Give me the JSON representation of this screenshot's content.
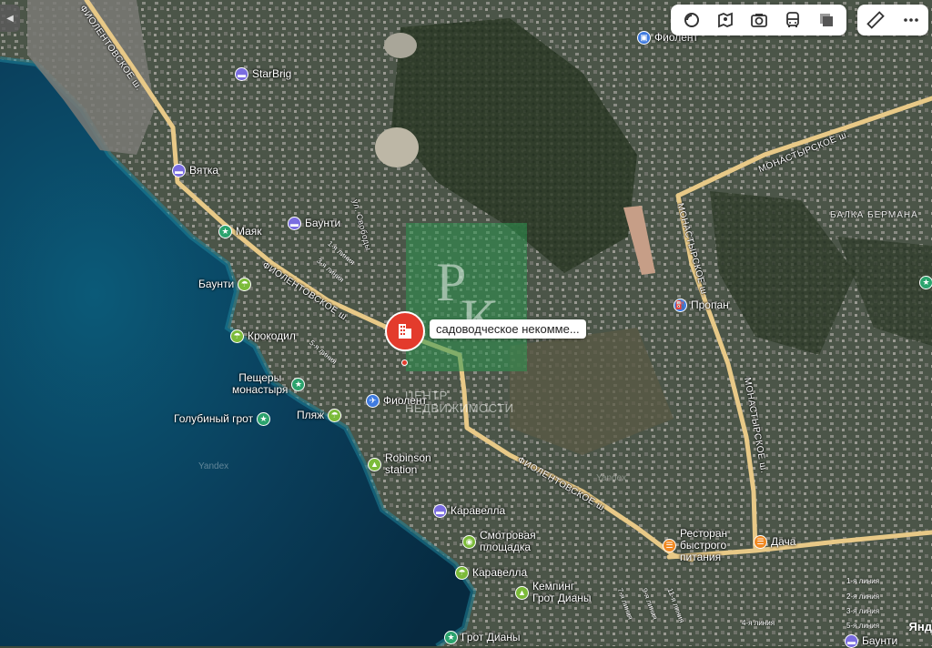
{
  "colors": {
    "road": "#e8c987",
    "sea": "#0c4a6a",
    "marker": "#e33b2c"
  },
  "roads": {
    "fiolent_upper": "ФИОЛЕНТОВСКОЕ ш.",
    "fiolent_mid": "ФИОЛЕНТОВСКОЕ ш.",
    "fiolent_lower": "ФИОЛЕНТОВСКОЕ ш.",
    "monastyr_top": "МОНАСТЫРСКОЕ ш.",
    "monastyr_right": "МОНАСТЫРСКОЕ ш.",
    "monastyr_left": "МОНАСТЫРСКОЕ ш.",
    "svobody": "ул. Свободы"
  },
  "areas": {
    "balka": "БАЛКА БЕРМАНА"
  },
  "lines": [
    "1-я линия",
    "2-я линия",
    "3-я линия",
    "4-я линия",
    "5-я линия",
    "1-я линия",
    "3-я линия",
    "5-я линия",
    "7-я линия",
    "9-я линия",
    "11-я линия"
  ],
  "pois": {
    "fiolent_top": "Фиолент",
    "starbrig": "StarBrig",
    "vyatka": "Вятка",
    "mayak": "Маяк",
    "baunti1": "Баунти",
    "baunti2": "Баунти",
    "krokodil": "Крокодил",
    "peshchery": "Пещеры\nмонастыря",
    "golubiny": "Голубиный грот",
    "plyazh": "Пляж",
    "fiolent_mid": "Фиолент",
    "robinson": "Robinson\nstation",
    "karavella1": "Каравелла",
    "smotrovaya": "Смотровая\nплощадка",
    "karavella2": "Каравелла",
    "kemping": "Кемпинг\nГрот Дианы",
    "grot_diany": "Грот Дианы",
    "propan": "Пропан",
    "restoran": "Ресторан\nбыстрого\nпитания",
    "dacha": "Дача",
    "baunti3": "Баунти"
  },
  "marker": {
    "label": "садоводческое некомме...",
    "icon": "building-icon"
  },
  "watermark": {
    "line1": "ЦЕНТР",
    "line2": "НЕДВИЖИМОСТИ",
    "logo": "РК"
  },
  "yandex": {
    "wm1": "Yandex",
    "wm2": "Yandex",
    "copyright": "Янд"
  },
  "toolbar": {
    "buttons": [
      "layers-icon",
      "panorama-icon",
      "camera-icon",
      "transit-icon",
      "stack-icon"
    ],
    "extra": [
      "ruler-icon",
      "more-icon"
    ]
  }
}
